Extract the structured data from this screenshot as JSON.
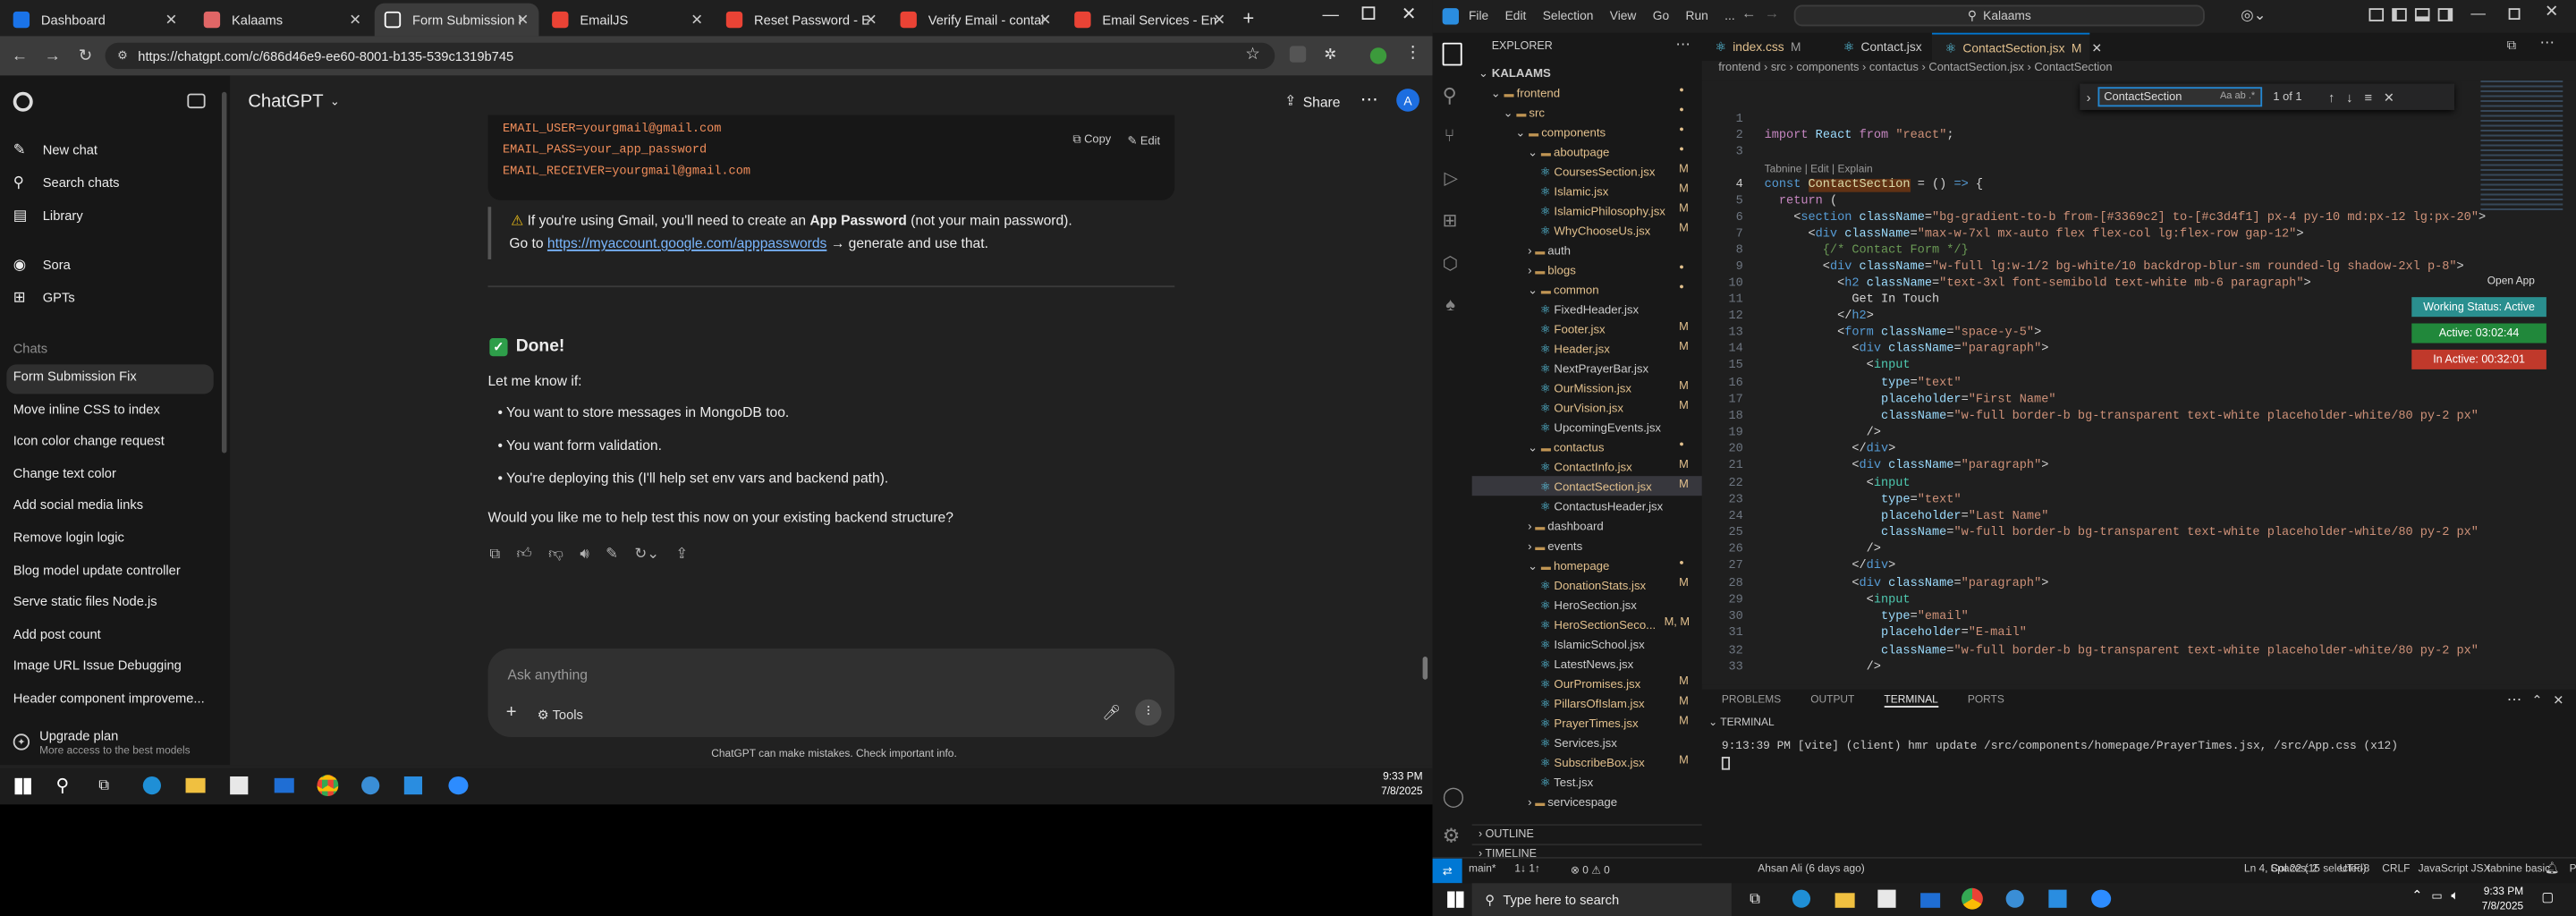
{
  "chrome": {
    "tabs": [
      {
        "title": "Dashboard",
        "favicon_color": "#1a73e8"
      },
      {
        "title": "Kalaams",
        "favicon_color": "#e06666"
      },
      {
        "title": "Form Submission Fix",
        "favicon_color": "#ffffff"
      },
      {
        "title": "EmailJS",
        "favicon_color": "#ea4335"
      },
      {
        "title": "Reset Password - Emai",
        "favicon_color": "#ea4335"
      },
      {
        "title": "Verify Email - contains",
        "favicon_color": "#ea4335"
      },
      {
        "title": "Email Services - Emaili",
        "favicon_color": "#ea4335"
      }
    ],
    "url": "https://chatgpt.com/c/686d46e9-ee60-8001-b135-539c1319b745"
  },
  "gpt": {
    "brand": "ChatGPT",
    "nav": [
      {
        "label": "New chat",
        "icon": "new-chat-icon"
      },
      {
        "label": "Search chats",
        "icon": "search-icon"
      },
      {
        "label": "Library",
        "icon": "library-icon"
      },
      {
        "label": "Sora",
        "icon": "sora-icon"
      },
      {
        "label": "GPTs",
        "icon": "gpts-icon"
      }
    ],
    "chats_heading": "Chats",
    "chats": [
      "Form Submission Fix",
      "Move inline CSS to index",
      "Icon color change request",
      "Change text color",
      "Add social media links",
      "Remove login logic",
      "Blog model update controller",
      "Serve static files Node.js",
      "Add post count",
      "Image URL Issue Debugging",
      "Header component improveme..."
    ],
    "upgrade_title": "Upgrade plan",
    "upgrade_sub": "More access to the best models",
    "share_label": "Share",
    "avatar_letter": "A",
    "code_lines": [
      "EMAIL_USER=yourgmail@gmail.com",
      "EMAIL_PASS=your_app_password",
      "EMAIL_RECEIVER=yourgmail@gmail.com"
    ],
    "copy_label": "Copy",
    "edit_label": "Edit",
    "warn_text_1": "If you're using Gmail, you'll need to create an",
    "warn_bold": "App Password",
    "warn_text_2": "(not your main password).",
    "goto_text": "Go to",
    "goto_link": "https://myaccount.google.com/apppasswords",
    "goto_rest": "→ generate and use that.",
    "done_heading": "Done!",
    "letmeknow": "Let me know if:",
    "bullets": [
      "You want to store messages in MongoDB too.",
      "You want form validation.",
      "You're deploying this (I'll help set env vars and backend path)."
    ],
    "question": "Would you like me to help test this now on your existing backend structure?",
    "input_placeholder": "Ask anything",
    "tools_label": "Tools",
    "disclaimer": "ChatGPT can make mistakes. Check important info."
  },
  "taskbar_left": {
    "time": "9:33 PM",
    "date": "7/8/2025"
  },
  "vscode": {
    "menu": [
      "File",
      "Edit",
      "Selection",
      "View",
      "Go",
      "Run",
      "..."
    ],
    "search": "Kalaams",
    "explorer_title": "EXPLORER",
    "tree": [
      {
        "label": "KALAAMS",
        "level": 0,
        "type": "root"
      },
      {
        "label": "frontend",
        "level": 1,
        "type": "folder-open",
        "mark": "dot"
      },
      {
        "label": "src",
        "level": 2,
        "type": "folder-open",
        "mark": "dot"
      },
      {
        "label": "components",
        "level": 3,
        "type": "folder-open",
        "mark": "dot"
      },
      {
        "label": "aboutpage",
        "level": 4,
        "type": "folder-open",
        "mark": "dot"
      },
      {
        "label": "CoursesSection.jsx",
        "level": 5,
        "type": "file",
        "mark": "M"
      },
      {
        "label": "Islamic.jsx",
        "level": 5,
        "type": "file",
        "mark": "M"
      },
      {
        "label": "IslamicPhilosophy.jsx",
        "level": 5,
        "type": "file",
        "mark": "M"
      },
      {
        "label": "WhyChooseUs.jsx",
        "level": 5,
        "type": "file",
        "mark": "M"
      },
      {
        "label": "auth",
        "level": 4,
        "type": "folder",
        "mark": ""
      },
      {
        "label": "blogs",
        "level": 4,
        "type": "folder",
        "mark": "dot"
      },
      {
        "label": "common",
        "level": 4,
        "type": "folder-open",
        "mark": "dot"
      },
      {
        "label": "FixedHeader.jsx",
        "level": 5,
        "type": "file",
        "mark": ""
      },
      {
        "label": "Footer.jsx",
        "level": 5,
        "type": "file",
        "mark": "M"
      },
      {
        "label": "Header.jsx",
        "level": 5,
        "type": "file",
        "mark": "M"
      },
      {
        "label": "NextPrayerBar.jsx",
        "level": 5,
        "type": "file",
        "mark": ""
      },
      {
        "label": "OurMission.jsx",
        "level": 5,
        "type": "file",
        "mark": "M"
      },
      {
        "label": "OurVision.jsx",
        "level": 5,
        "type": "file",
        "mark": "M"
      },
      {
        "label": "UpcomingEvents.jsx",
        "level": 5,
        "type": "file",
        "mark": ""
      },
      {
        "label": "contactus",
        "level": 4,
        "type": "folder-open",
        "mark": "dot"
      },
      {
        "label": "ContactInfo.jsx",
        "level": 5,
        "type": "file",
        "mark": "M"
      },
      {
        "label": "ContactSection.jsx",
        "level": 5,
        "type": "file",
        "mark": "M",
        "selected": true
      },
      {
        "label": "ContactusHeader.jsx",
        "level": 5,
        "type": "file",
        "mark": ""
      },
      {
        "label": "dashboard",
        "level": 4,
        "type": "folder",
        "mark": ""
      },
      {
        "label": "events",
        "level": 4,
        "type": "folder",
        "mark": ""
      },
      {
        "label": "homepage",
        "level": 4,
        "type": "folder-open",
        "mark": "dot"
      },
      {
        "label": "DonationStats.jsx",
        "level": 5,
        "type": "file",
        "mark": "M"
      },
      {
        "label": "HeroSection.jsx",
        "level": 5,
        "type": "file",
        "mark": ""
      },
      {
        "label": "HeroSectionSeco...",
        "level": 5,
        "type": "file",
        "mark": "M, M"
      },
      {
        "label": "IslamicSchool.jsx",
        "level": 5,
        "type": "file",
        "mark": ""
      },
      {
        "label": "LatestNews.jsx",
        "level": 5,
        "type": "file",
        "mark": ""
      },
      {
        "label": "OurPromises.jsx",
        "level": 5,
        "type": "file",
        "mark": "M"
      },
      {
        "label": "PillarsOfIslam.jsx",
        "level": 5,
        "type": "file",
        "mark": "M"
      },
      {
        "label": "PrayerTimes.jsx",
        "level": 5,
        "type": "file",
        "mark": "M"
      },
      {
        "label": "Services.jsx",
        "level": 5,
        "type": "file",
        "mark": ""
      },
      {
        "label": "SubscribeBox.jsx",
        "level": 5,
        "type": "file",
        "mark": "M"
      },
      {
        "label": "Test.jsx",
        "level": 5,
        "type": "file",
        "mark": ""
      },
      {
        "label": "servicespage",
        "level": 4,
        "type": "folder",
        "mark": ""
      }
    ],
    "outline": "OUTLINE",
    "timeline": "TIMELINE",
    "tabs": [
      {
        "label": "index.css",
        "mark": "M",
        "color": "#519aba"
      },
      {
        "label": "Contact.jsx",
        "mark": "",
        "color": "#519aba"
      },
      {
        "label": "ContactSection.jsx",
        "mark": "M",
        "color": "#519aba",
        "active": true
      }
    ],
    "breadcrumb": [
      "frontend",
      "src",
      "components",
      "contactus",
      "ContactSection.jsx",
      "ContactSection"
    ],
    "find_value": "ContactSection",
    "find_count": "1 of 1",
    "tabnine_hint": "Tabnine | Edit | Explain",
    "open_app": "Open App",
    "working_status": "Working Status: Active",
    "timer_active": "Active: 03:02:44",
    "timer_inactive": "In Active: 00:32:01",
    "code": [
      {
        "n": "1",
        "html": ""
      },
      {
        "n": "2",
        "html": "<span class='p'>import</span> <span class='a'>React</span> <span class='p'>from</span> <span class='s'>\"react\"</span>;"
      },
      {
        "n": "3",
        "html": ""
      },
      {
        "n": "4",
        "html": "<span class='k'>const</span> <span class='f' style='background:#613214'>ContactSection</span> = () <span class='k'>=&gt;</span> {"
      },
      {
        "n": "5",
        "html": "  <span class='p'>return</span> ("
      },
      {
        "n": "6",
        "html": "    &lt;<span class='k'>section</span> <span class='a'>className</span>=<span class='s'>\"bg-gradient-to-b from-[#3369c2] to-[#c3d4f1] px-4 py-10 md:px-12 lg:px-20\"</span>&gt;"
      },
      {
        "n": "7",
        "html": "      &lt;<span class='k'>div</span> <span class='a'>className</span>=<span class='s'>\"max-w-7xl mx-auto flex flex-col lg:flex-row gap-12\"</span>&gt;"
      },
      {
        "n": "8",
        "html": "        <span class='c'>{/* Contact Form */}</span>"
      },
      {
        "n": "9",
        "html": "        &lt;<span class='k'>div</span> <span class='a'>className</span>=<span class='s'>\"w-full lg:w-1/2 bg-white/10 backdrop-blur-sm rounded-lg shadow-2xl p-8\"</span>&gt;"
      },
      {
        "n": "10",
        "html": "          &lt;<span class='k'>h2</span> <span class='a'>className</span>=<span class='s'>\"text-3xl font-semibold text-white mb-6 paragraph\"</span>&gt;"
      },
      {
        "n": "11",
        "html": "            Get In Touch"
      },
      {
        "n": "12",
        "html": "          &lt;/<span class='k'>h2</span>&gt;"
      },
      {
        "n": "13",
        "html": "          &lt;<span class='k'>form</span> <span class='a'>className</span>=<span class='s'>\"space-y-5\"</span>&gt;"
      },
      {
        "n": "14",
        "html": "            &lt;<span class='k'>div</span> <span class='a'>className</span>=<span class='s'>\"paragraph\"</span>&gt;"
      },
      {
        "n": "15",
        "html": "              &lt;<span class='t'>input</span>"
      },
      {
        "n": "16",
        "html": "                <span class='a'>type</span>=<span class='s'>\"text\"</span>"
      },
      {
        "n": "17",
        "html": "                <span class='a'>placeholder</span>=<span class='s'>\"First Name\"</span>"
      },
      {
        "n": "18",
        "html": "                <span class='a'>className</span>=<span class='s'>\"w-full border-b bg-transparent text-white placeholder-white/80 py-2 px\"</span>"
      },
      {
        "n": "19",
        "html": "              /&gt;"
      },
      {
        "n": "20",
        "html": "            &lt;/<span class='k'>div</span>&gt;"
      },
      {
        "n": "21",
        "html": "            &lt;<span class='k'>div</span> <span class='a'>className</span>=<span class='s'>\"paragraph\"</span>&gt;"
      },
      {
        "n": "22",
        "html": "              &lt;<span class='t'>input</span>"
      },
      {
        "n": "23",
        "html": "                <span class='a'>type</span>=<span class='s'>\"text\"</span>"
      },
      {
        "n": "24",
        "html": "                <span class='a'>placeholder</span>=<span class='s'>\"Last Name\"</span>"
      },
      {
        "n": "25",
        "html": "                <span class='a'>className</span>=<span class='s'>\"w-full border-b bg-transparent text-white placeholder-white/80 py-2 px\"</span>"
      },
      {
        "n": "26",
        "html": "              /&gt;"
      },
      {
        "n": "27",
        "html": "            &lt;/<span class='k'>div</span>&gt;"
      },
      {
        "n": "28",
        "html": "            &lt;<span class='k'>div</span> <span class='a'>className</span>=<span class='s'>\"paragraph\"</span>&gt;"
      },
      {
        "n": "29",
        "html": "              &lt;<span class='t'>input</span>"
      },
      {
        "n": "30",
        "html": "                <span class='a'>type</span>=<span class='s'>\"email\"</span>"
      },
      {
        "n": "31",
        "html": "                <span class='a'>placeholder</span>=<span class='s'>\"E-mail\"</span>"
      },
      {
        "n": "32",
        "html": "                <span class='a'>className</span>=<span class='s'>\"w-full border-b bg-transparent text-white placeholder-white/80 py-2 px\"</span>"
      },
      {
        "n": "33",
        "html": "              /&gt;"
      }
    ],
    "panel_tabs": [
      "PROBLEMS",
      "OUTPUT",
      "TERMINAL",
      "PORTS"
    ],
    "terminal_label": "TERMINAL",
    "terminal_line": "9:13:39 PM [vite] (client) hmr update /src/components/homepage/PrayerTimes.jsx, /src/App.css (x12)",
    "status": {
      "branch": "main*",
      "sync": "1↓ 1↑",
      "errors": "⊗ 0 ⚠ 0",
      "blame": "Ahsan Ali (6 days ago)",
      "position": "Ln 4, Col 22 (15 selected)",
      "spaces": "Spaces: 2",
      "encoding": "UTF-8",
      "eol": "CRLF",
      "language": "JavaScript JSX",
      "tabnine": "tabnine basic",
      "prettier": "Prettier"
    }
  },
  "taskbar_right": {
    "search_placeholder": "Type here to search",
    "time": "9:33 PM",
    "date": "7/8/2025"
  }
}
